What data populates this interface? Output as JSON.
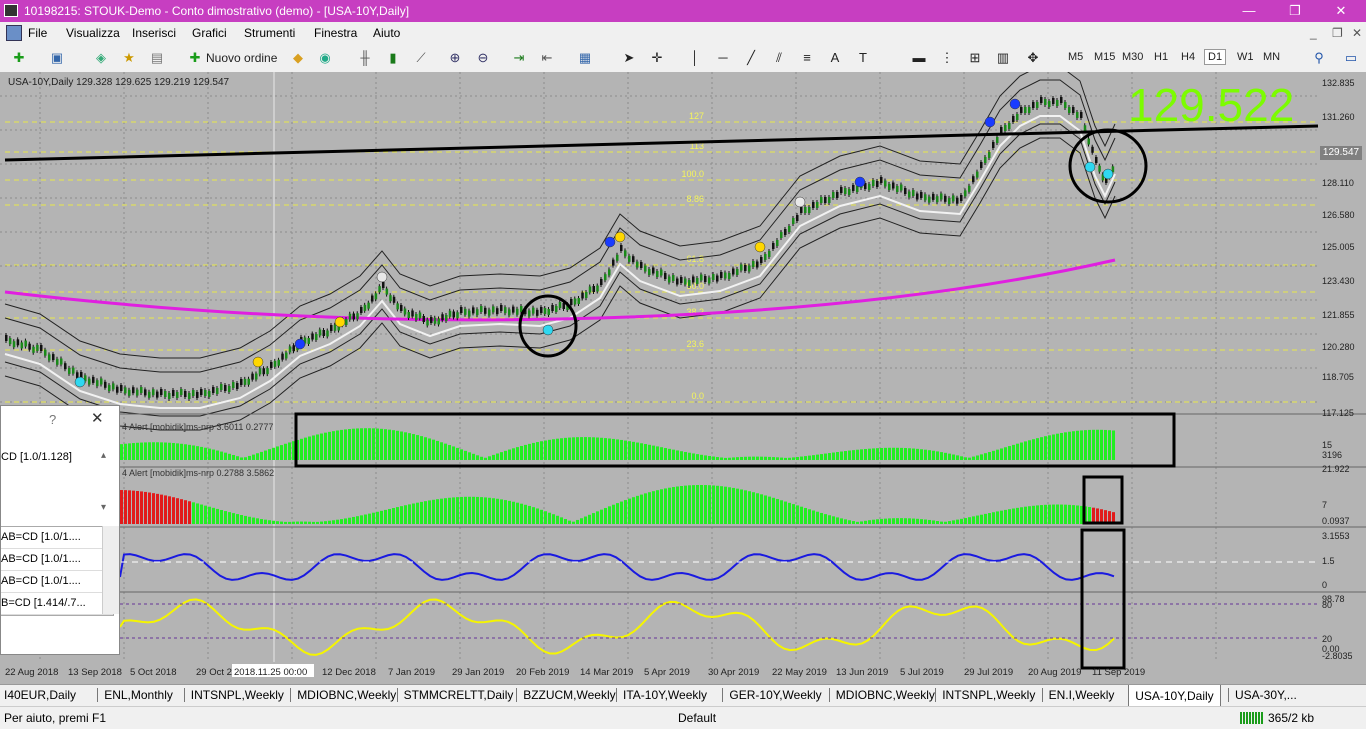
{
  "window": {
    "title": "10198215: STOUK-Demo - Conto dimostrativo (demo) - [USA-10Y,Daily]",
    "controls": [
      "—",
      "❐",
      "✕"
    ]
  },
  "menu": {
    "items": [
      "File",
      "Visualizza",
      "Inserisci",
      "Grafici",
      "Strumenti",
      "Finestra",
      "Aiuto"
    ],
    "child_controls": [
      "_",
      "❐",
      "✕"
    ]
  },
  "toolbar": {
    "new_order_label": "Nuovo ordine",
    "timeframes": [
      "M5",
      "M15",
      "M30",
      "H1",
      "H4",
      "D1",
      "W1",
      "MN"
    ],
    "active_timeframe": "D1"
  },
  "chart": {
    "symbol_info": "USA-10Y,Daily  129.328 129.625 129.219 129.547",
    "current_price_label": "129.547",
    "big_price": "129.522",
    "big_price_color": "#7cfc00",
    "background": "#b4b4b4",
    "price_scale": [
      "132.835",
      "131.260",
      "129.547",
      "128.110",
      "126.580",
      "125.005",
      "123.430",
      "121.855",
      "120.280",
      "118.705",
      "117.125"
    ],
    "fib_levels": [
      "127",
      "113",
      "100.0",
      "8.86",
      "61.8",
      "50.0",
      "38.2",
      "23.6",
      "0.0"
    ],
    "date_labels": [
      "22 Aug 2018",
      "13 Sep 2018",
      "5 Oct 2018",
      "29 Oct 2018",
      "2018.11.25 00:00",
      "12 Dec 2018",
      "7 Jan 2019",
      "29 Jan 2019",
      "20 Feb 2019",
      "14 Mar 2019",
      "5 Apr 2019",
      "30 Apr 2019",
      "22 May 2019",
      "13 Jun 2019",
      "5 Jul 2019",
      "29 Jul 2019",
      "20 Aug 2019",
      "11 Sep 2019"
    ],
    "indicator1": {
      "label": "4 Alert [mobidik]ms-nrp 3.6011 0.2777",
      "scale": [
        "15",
        "3196"
      ]
    },
    "indicator2": {
      "label": "4 Alert [mobidik]ms-nrp 0.2788 3.5862",
      "scale": [
        "21.922",
        "7",
        "0.0937"
      ]
    },
    "indicator3": {
      "scale": [
        "3.1553",
        "1.5",
        "0"
      ]
    },
    "indicator4": {
      "scale": [
        "98.78",
        "80",
        "20",
        "0.00",
        "-2.8035"
      ]
    }
  },
  "dialog": {
    "help": "?",
    "close": "✕",
    "field_value": "CD [1.0/1.128]",
    "options": [
      "AB=CD [1.0/1....",
      "AB=CD [1.0/1....",
      "AB=CD [1.0/1....",
      "B=CD [1.414/.7..."
    ]
  },
  "tabs": {
    "items": [
      "I40EUR,Daily",
      "ENL,Monthly",
      "INTSNPL,Weekly",
      "MDIOBNC,Weekly",
      "STMMCRELTT,Daily",
      "BZZUCM,Weekly",
      "ITA-10Y,Weekly",
      "GER-10Y,Weekly",
      "MDIOBNC,Weekly",
      "INTSNPL,Weekly",
      "EN.I,Weekly",
      "USA-10Y,Daily",
      "USA-30Y,..."
    ],
    "active_index": 11
  },
  "status": {
    "help_text": "Per aiuto, premi F1",
    "profile": "Default",
    "traffic": "365/2 kb"
  }
}
